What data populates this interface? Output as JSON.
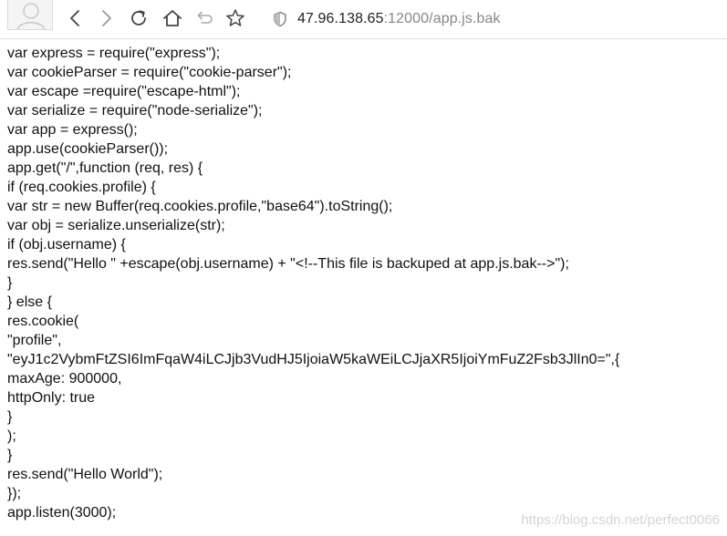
{
  "browser": {
    "address_bar": {
      "host": "47.96.138.65",
      "rest": ":12000/app.js.bak"
    },
    "icons": {
      "back": "arrow-left-icon",
      "forward": "arrow-right-icon",
      "reload": "reload-icon",
      "home": "home-icon",
      "undo": "undo-icon",
      "bookmark": "star-icon",
      "security": "shield-icon",
      "avatar": "user-avatar-icon"
    },
    "colors": {
      "host_text": "#222222",
      "path_text": "#888888",
      "icon": "#555555"
    }
  },
  "page": {
    "lines": [
      "var express = require(\"express\");",
      "var cookieParser = require(\"cookie-parser\");",
      "var escape =require(\"escape-html\");",
      "var serialize = require(\"node-serialize\");",
      "var app = express();",
      "app.use(cookieParser());",
      "app.get(\"/\",function (req, res) {",
      "if (req.cookies.profile) {",
      "var str = new Buffer(req.cookies.profile,\"base64\").toString();",
      "var obj = serialize.unserialize(str);",
      "if (obj.username) {",
      "res.send(\"Hello \" +escape(obj.username) + \"<!--This file is backuped at app.js.bak-->\");",
      "}",
      "} else {",
      "res.cookie(",
      "\"profile\",",
      "\"eyJ1c2VybmFtZSI6ImFqaW4iLCJjb3VudHJ5IjoiaW5kaWEiLCJjaXR5IjoiYmFuZ2Fsb3JlIn0=\",{",
      "maxAge: 900000,",
      "httpOnly: true",
      "}",
      ");",
      "}",
      "res.send(\"Hello World\");",
      "});",
      "app.listen(3000);"
    ],
    "watermark": "https://blog.csdn.net/perfect0066"
  }
}
